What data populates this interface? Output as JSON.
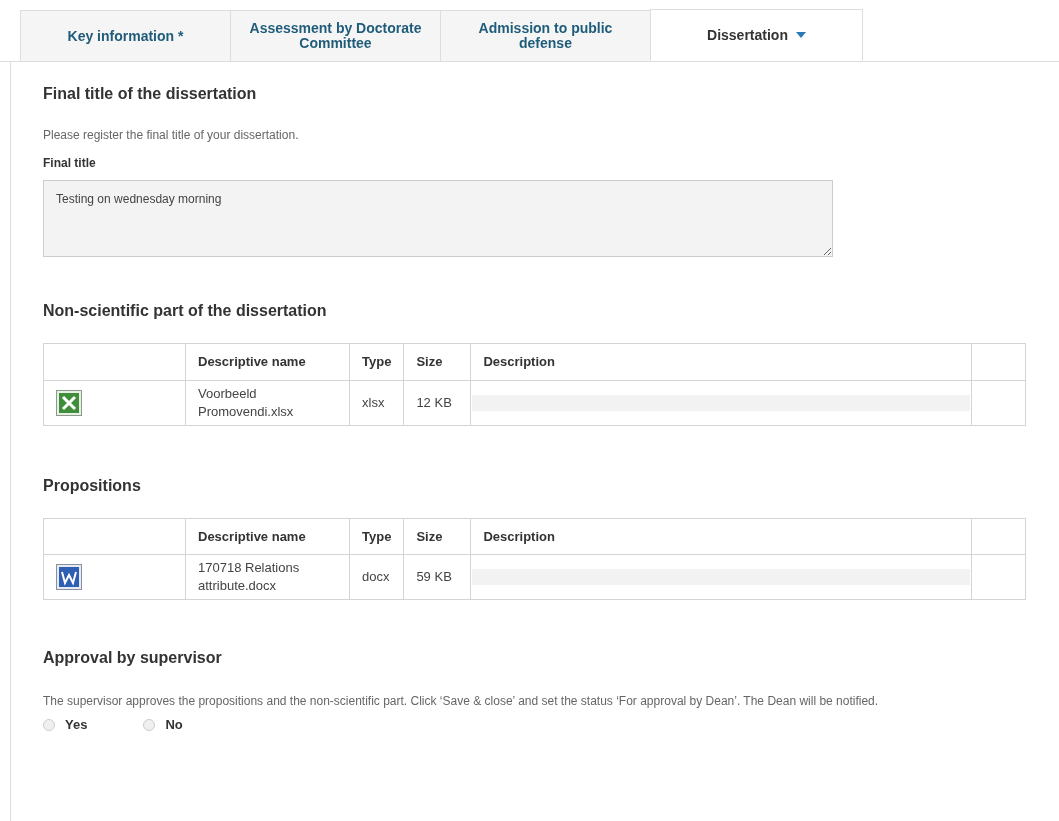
{
  "tabs": [
    {
      "label": "Key information *",
      "selected": false
    },
    {
      "label": "Assessment by Doctorate Committee",
      "selected": false
    },
    {
      "label": "Admission to public defense",
      "selected": false
    },
    {
      "label": "Dissertation",
      "selected": true
    }
  ],
  "final_title": {
    "heading": "Final title of the dissertation",
    "instruction": "Please register the final title of your dissertation.",
    "label": "Final title",
    "value": "Testing on wednesday morning"
  },
  "file_sections": [
    {
      "heading": "Non-scientific part of the dissertation",
      "columns": [
        "Descriptive name",
        "Type",
        "Size",
        "Description"
      ],
      "rows": [
        {
          "kind": "spreadsheet",
          "name": "Voorbeeld Promovendi.xlsx",
          "type": "xlsx",
          "size": "12 KB"
        }
      ]
    },
    {
      "heading": "Propositions",
      "columns": [
        "Descriptive name",
        "Type",
        "Size",
        "Description"
      ],
      "rows": [
        {
          "kind": "document",
          "name": "170718 Relations attribute.docx",
          "type": "docx",
          "size": "59 KB"
        }
      ]
    }
  ],
  "approval": {
    "heading": "Approval by supervisor",
    "text": "The supervisor approves the propositions and the non-scientific part. Click ‘Save & close’ and set the status ‘For approval by Dean’. The Dean will be notified.",
    "options": [
      {
        "label": "Yes",
        "selected": false
      },
      {
        "label": "No",
        "selected": false
      }
    ]
  }
}
